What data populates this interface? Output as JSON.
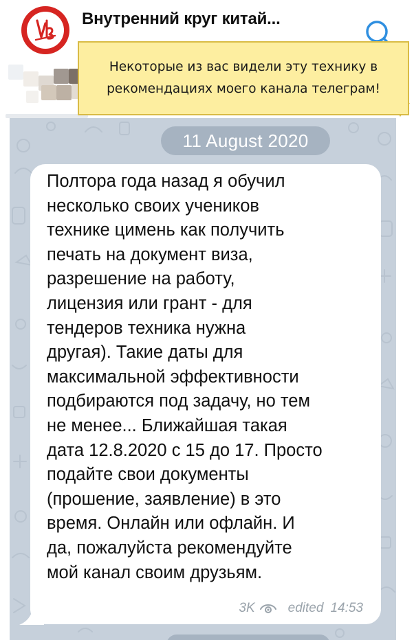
{
  "header": {
    "channel_title": "Внутренний круг китай...",
    "avatar_icon": "channel-logo-icon",
    "search_icon": "search-icon"
  },
  "note": {
    "text": "Некоторые из вас видели эту технику в рекомендациях моего канала телеграм!"
  },
  "chat": {
    "date_label": "11 August 2020",
    "message": {
      "text": "Полтора года назад я обучил\nнесколько своих учеников\nтехнике цимень как получить\nпечать на документ  виза,\nразрешение на работу,\nлицензия или грант - для\nтендеров техника нужна\nдругая). Такие даты для\nмаксимальной эффективности\nподбираются под задачу, но тем\nне менее... Ближайшая такая\nдата 12.8.2020 с 15 до 17. Просто\nподайте свои документы\n(прошение, заявление) в это\nвремя. Онлайн или офлайн. И\nда, пожалуйста рекомендуйте\nмой канал своим друзьям.",
      "views": "3K",
      "edited_label": "edited",
      "time": "14:53"
    }
  },
  "colors": {
    "chat_background": "#c6d0db",
    "date_pill": "#a6b3c1",
    "note_background": "#fdeea0",
    "note_border": "#d9bb45",
    "avatar_red": "#d62521",
    "search_blue": "#2f8fe0"
  }
}
